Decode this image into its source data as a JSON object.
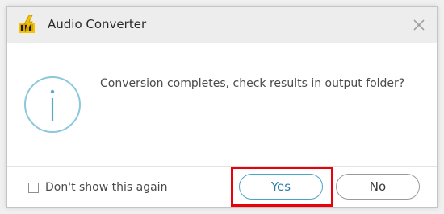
{
  "window": {
    "title": "Audio Converter",
    "app_icon": "lightning-folder-icon",
    "close_icon": "close-icon"
  },
  "content": {
    "icon": "info-icon",
    "message": "Conversion completes, check results in output folder?"
  },
  "footer": {
    "checkbox_label": "Don't show this again",
    "checkbox_checked": false,
    "yes_label": "Yes",
    "no_label": "No"
  },
  "colors": {
    "accent": "#4aa3c9",
    "highlight": "#e8000b",
    "icon_yellow": "#f5c400"
  }
}
